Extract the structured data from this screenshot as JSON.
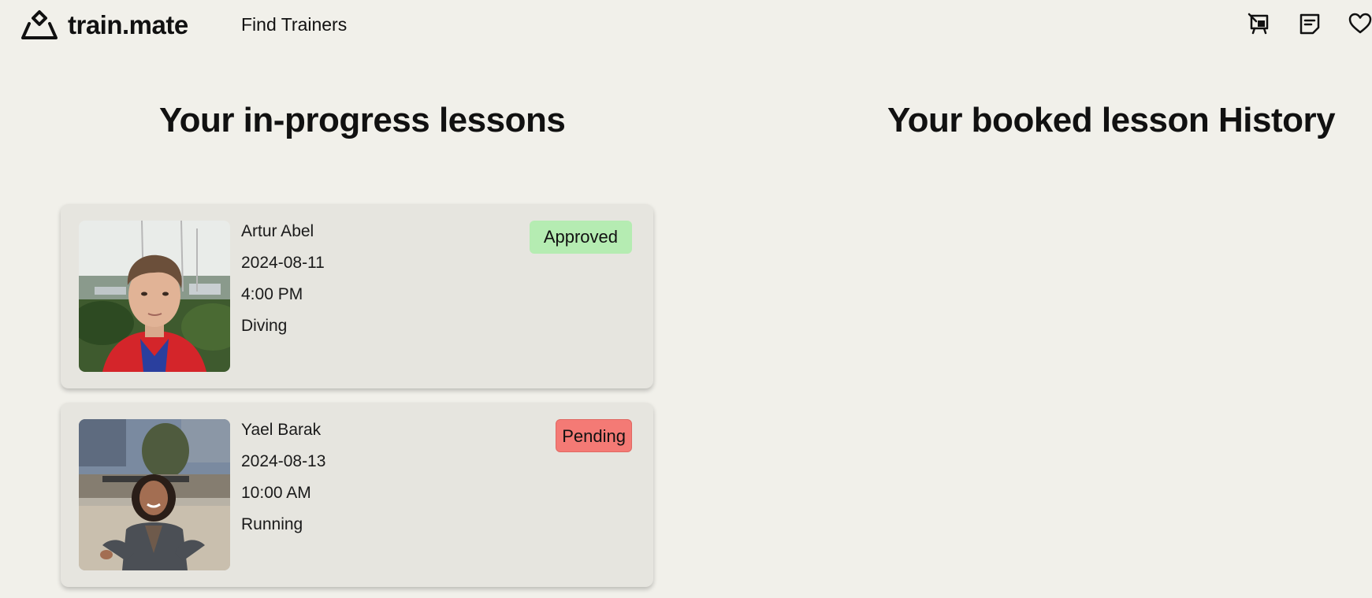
{
  "header": {
    "logo_text": "train.mate",
    "nav": {
      "find_trainers": "Find Trainers"
    },
    "icons": [
      "lesson-board-icon",
      "messages-icon",
      "favorites-heart-icon"
    ]
  },
  "sections": {
    "in_progress_title": "Your in-progress lessons",
    "history_title": "Your booked lesson History"
  },
  "lessons": [
    {
      "trainer": "Artur Abel",
      "date": "2024-08-11",
      "time": "4:00 PM",
      "sport": "Diving",
      "status": "Approved",
      "status_color": "#b5ecb2"
    },
    {
      "trainer": "Yael Barak",
      "date": "2024-08-13",
      "time": "10:00 AM",
      "sport": "Running",
      "status": "Pending",
      "status_color": "#f47a75"
    }
  ]
}
